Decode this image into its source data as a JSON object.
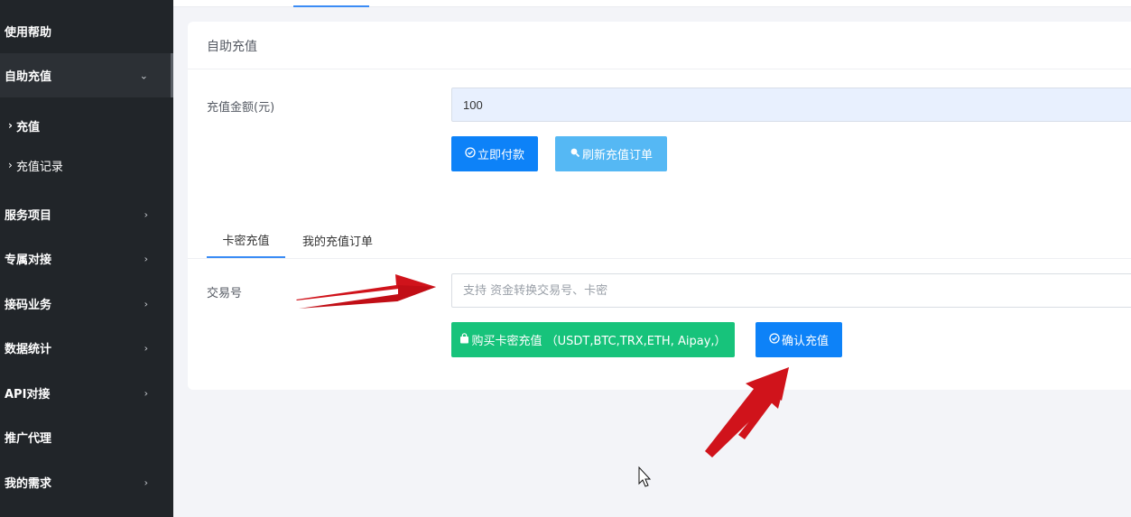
{
  "sidebar": {
    "items": [
      {
        "label": "使用帮助",
        "has_chevron": false
      },
      {
        "label": "自助充值",
        "chevron": "⌄",
        "active": true
      },
      {
        "label": "服务项目",
        "chevron": "›"
      },
      {
        "label": "专属对接",
        "chevron": "›"
      },
      {
        "label": "接码业务",
        "chevron": "›"
      },
      {
        "label": "数据统计",
        "chevron": "›"
      },
      {
        "label": "API对接",
        "chevron": "›"
      },
      {
        "label": "推广代理",
        "has_chevron": false
      },
      {
        "label": "我的需求",
        "chevron": "›"
      }
    ],
    "sub_items": [
      {
        "label": "充值",
        "arrow": "›",
        "current": true
      },
      {
        "label": "充值记录",
        "arrow": "›"
      }
    ]
  },
  "card": {
    "title": "自助充值",
    "amount_label": "充值金额(元)",
    "amount_value": "100",
    "pay_button": "立即付款",
    "refresh_button": "刷新充值订单"
  },
  "tabs": {
    "card_tab": "卡密充值",
    "orders_tab": "我的充值订单"
  },
  "txn": {
    "label": "交易号",
    "placeholder": "支持 资金转换交易号、卡密",
    "buy_button": "购买卡密充值 （USDT,BTC,TRX,ETH, Aipay,）",
    "confirm_button": "确认充值"
  },
  "colors": {
    "sidebar_bg": "#212529",
    "primary": "#0d82f8",
    "info": "#55b8f4",
    "success": "#17c37b",
    "annotation_arrow": "#d0131b"
  },
  "icons": {
    "pay": "check-circle-icon",
    "refresh": "search-icon",
    "buy": "shopping-bag-icon",
    "confirm": "check-circle-icon"
  }
}
